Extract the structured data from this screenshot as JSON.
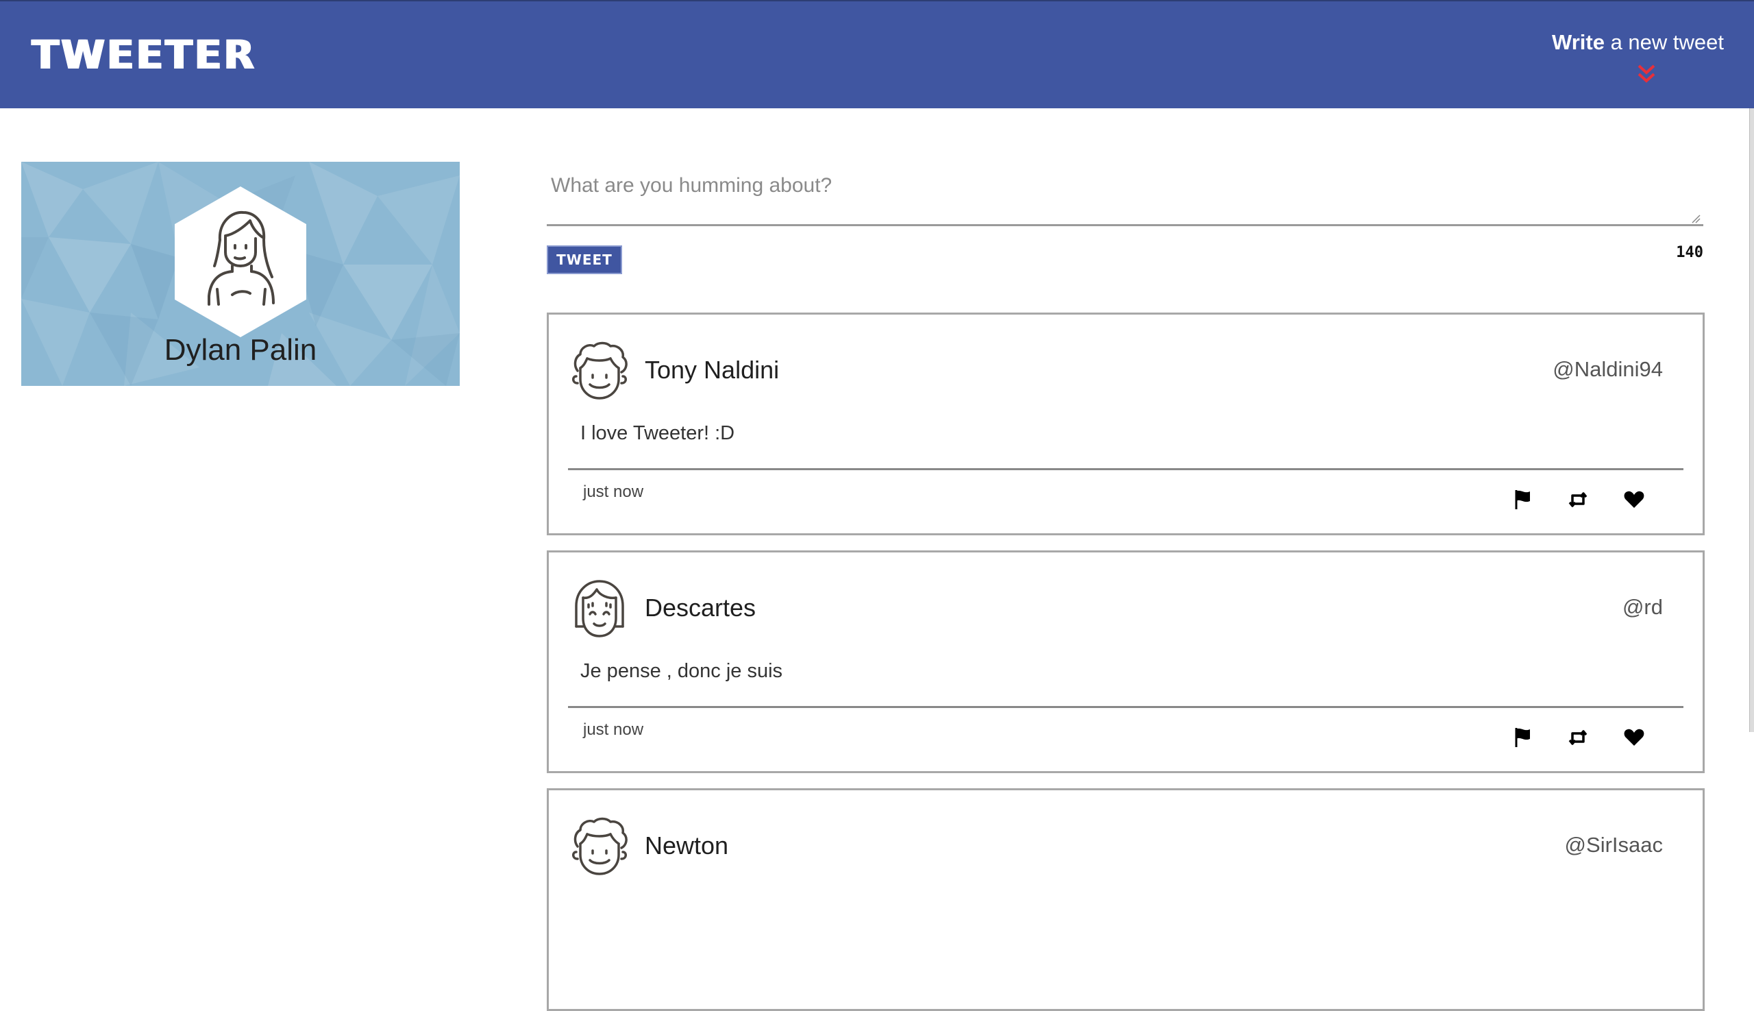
{
  "nav": {
    "brand": "TWEETER",
    "compose_bold": "Write",
    "compose_rest": " a new tweet",
    "compose_icon": "double-chevron-down-icon"
  },
  "profile": {
    "name": "Dylan Palin",
    "avatar_icon": "woman-avatar-icon"
  },
  "composer": {
    "placeholder": "What are you humming about?",
    "button_label": "TWEET",
    "counter": "140"
  },
  "tweets": [
    {
      "name": "Tony Naldini",
      "handle": "@Naldini94",
      "text": "I love Tweeter! :D",
      "time": "just now",
      "avatar_icon": "curly-hair-man-icon"
    },
    {
      "name": "Descartes",
      "handle": "@rd",
      "text": "Je pense , donc je suis",
      "time": "just now",
      "avatar_icon": "bob-hair-woman-icon"
    },
    {
      "name": "Newton",
      "handle": "@SirIsaac",
      "text": "",
      "time": "",
      "avatar_icon": "curly-hair-man-icon"
    }
  ],
  "colors": {
    "nav": "#4056a1",
    "accent_red": "#e8303a",
    "profile_bg": "#8cb8d3"
  }
}
